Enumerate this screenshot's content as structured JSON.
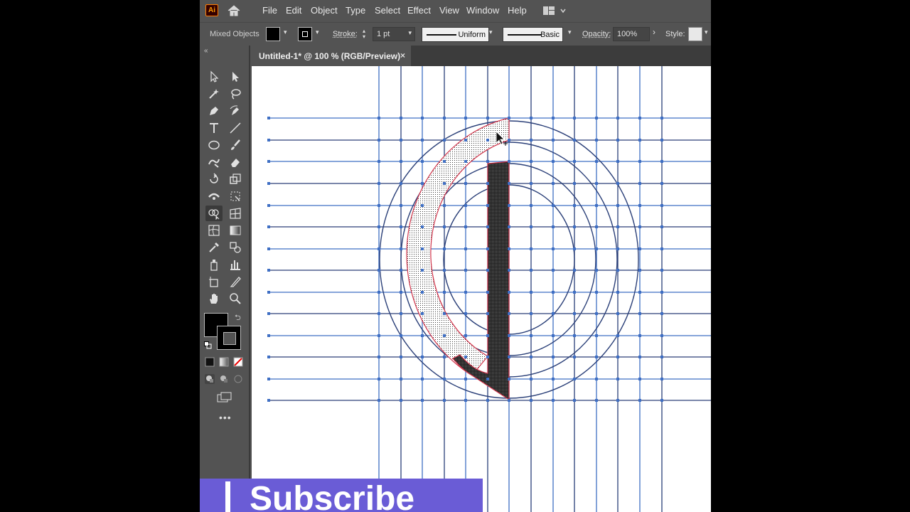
{
  "app": {
    "logo_text": "Ai",
    "menu": [
      "File",
      "Edit",
      "Object",
      "Type",
      "Select",
      "Effect",
      "View",
      "Window",
      "Help"
    ]
  },
  "control_bar": {
    "selection_label": "Mixed Objects",
    "stroke_label": "Stroke:",
    "stroke_weight": "1 pt",
    "stroke_profile": "Uniform",
    "brush": "Basic",
    "opacity_label": "Opacity:",
    "opacity_value": "100%",
    "style_label": "Style:"
  },
  "document": {
    "tab_title": "Untitled-1* @ 100 % (RGB/Preview)",
    "close_glyph": "×"
  },
  "toolbar": {
    "collapse_glyph": "«",
    "more_glyph": "•••",
    "fill_color": "#000000",
    "stroke_color": "#000000"
  },
  "canvas": {
    "grid_color": "#3f6fc4",
    "dark_line_color": "#2a3f78",
    "selection_color": "#d0344a"
  },
  "overlay": {
    "subscribe_text": "Subscribe",
    "subscribe_bg": "#6a5cd6"
  }
}
